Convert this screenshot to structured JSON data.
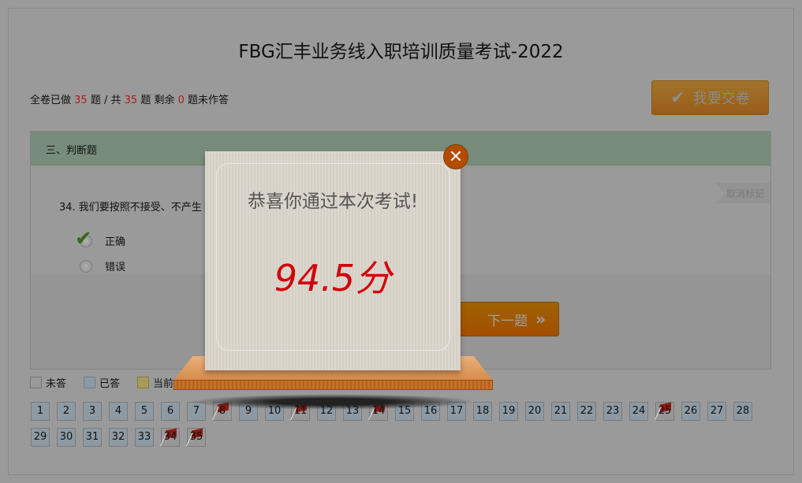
{
  "title": "FBG汇丰业务线入职培训质量考试-2022",
  "status": {
    "done_prefix": "全卷已做",
    "done": "35",
    "mid1": "题 / 共",
    "total": "35",
    "mid2": "题 剩余",
    "remaining": "0",
    "suffix": "题未作答"
  },
  "submit_label": "我要交卷",
  "section": {
    "heading": "三、判断题",
    "question": "34. 我们要按照不接受、不产生",
    "unmark_label": "取消标记",
    "options": [
      {
        "label": "正确",
        "selected": true
      },
      {
        "label": "错误",
        "selected": false
      }
    ],
    "next_label": "下一题"
  },
  "legend": [
    {
      "label": "未答",
      "color": "#999999"
    },
    {
      "label": "已答",
      "color": "#8d9aa3"
    },
    {
      "label": "当前",
      "color": "#a89a5a"
    }
  ],
  "questions": {
    "count": 35,
    "flagged": [
      8,
      11,
      14,
      25,
      34,
      35
    ]
  },
  "modal": {
    "message": "恭喜你通过本次考试!",
    "score": "94.5分",
    "close_icon": "close-icon"
  },
  "colors": {
    "accent_orange": "#b24d00",
    "score_red": "#d0000a",
    "section_green": "#778c7a"
  }
}
